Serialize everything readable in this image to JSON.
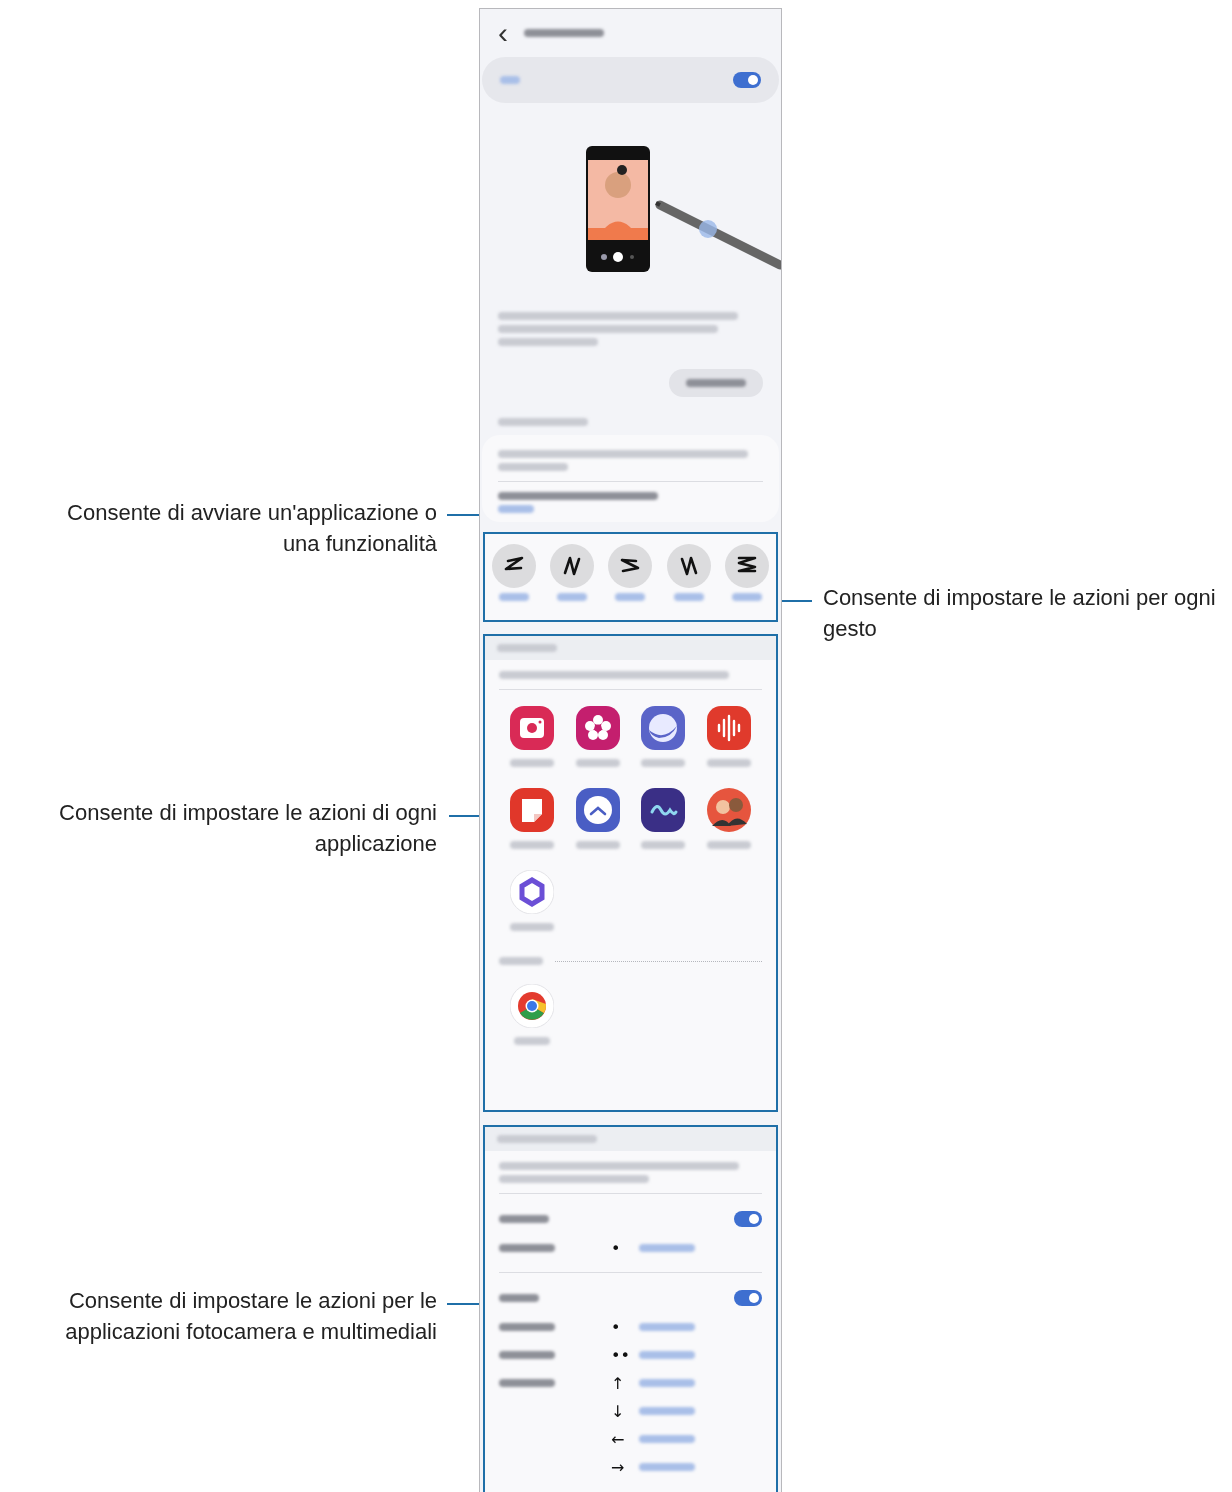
{
  "callouts": [
    {
      "text": "Consente di avviare un'applicazione o una funzionalità",
      "kind": "left"
    },
    {
      "text": "Consente di impostare le azioni per ogni gesto",
      "kind": "right"
    },
    {
      "text": "Consente di impostare le azioni di ogni applicazione",
      "kind": "left"
    },
    {
      "text": "Consente di impostare le azioni per le applicazioni fotocamera e multimediali",
      "kind": "left"
    }
  ],
  "header": {
    "back": "‹"
  },
  "main_toggle": {
    "on": true
  },
  "gestures": [
    {
      "kind": "left"
    },
    {
      "kind": "up"
    },
    {
      "kind": "right"
    },
    {
      "kind": "down"
    },
    {
      "kind": "zigzag"
    }
  ],
  "apps": [
    {
      "kind": "camera"
    },
    {
      "kind": "flower"
    },
    {
      "kind": "globe"
    },
    {
      "kind": "wave"
    },
    {
      "kind": "note"
    },
    {
      "kind": "chevron"
    },
    {
      "kind": "squiggle"
    },
    {
      "kind": "people"
    },
    {
      "kind": "hexagon"
    }
  ],
  "other_apps": [
    {
      "kind": "ring"
    }
  ],
  "camera": {
    "on": true,
    "rows": [
      {
        "symbol": "•"
      }
    ]
  },
  "media": {
    "on": true,
    "rows": [
      {
        "symbol": "•"
      },
      {
        "symbol": "••"
      },
      {
        "symbol": "↑"
      },
      {
        "symbol": "↓"
      },
      {
        "symbol": "←"
      },
      {
        "symbol": "→"
      }
    ]
  }
}
